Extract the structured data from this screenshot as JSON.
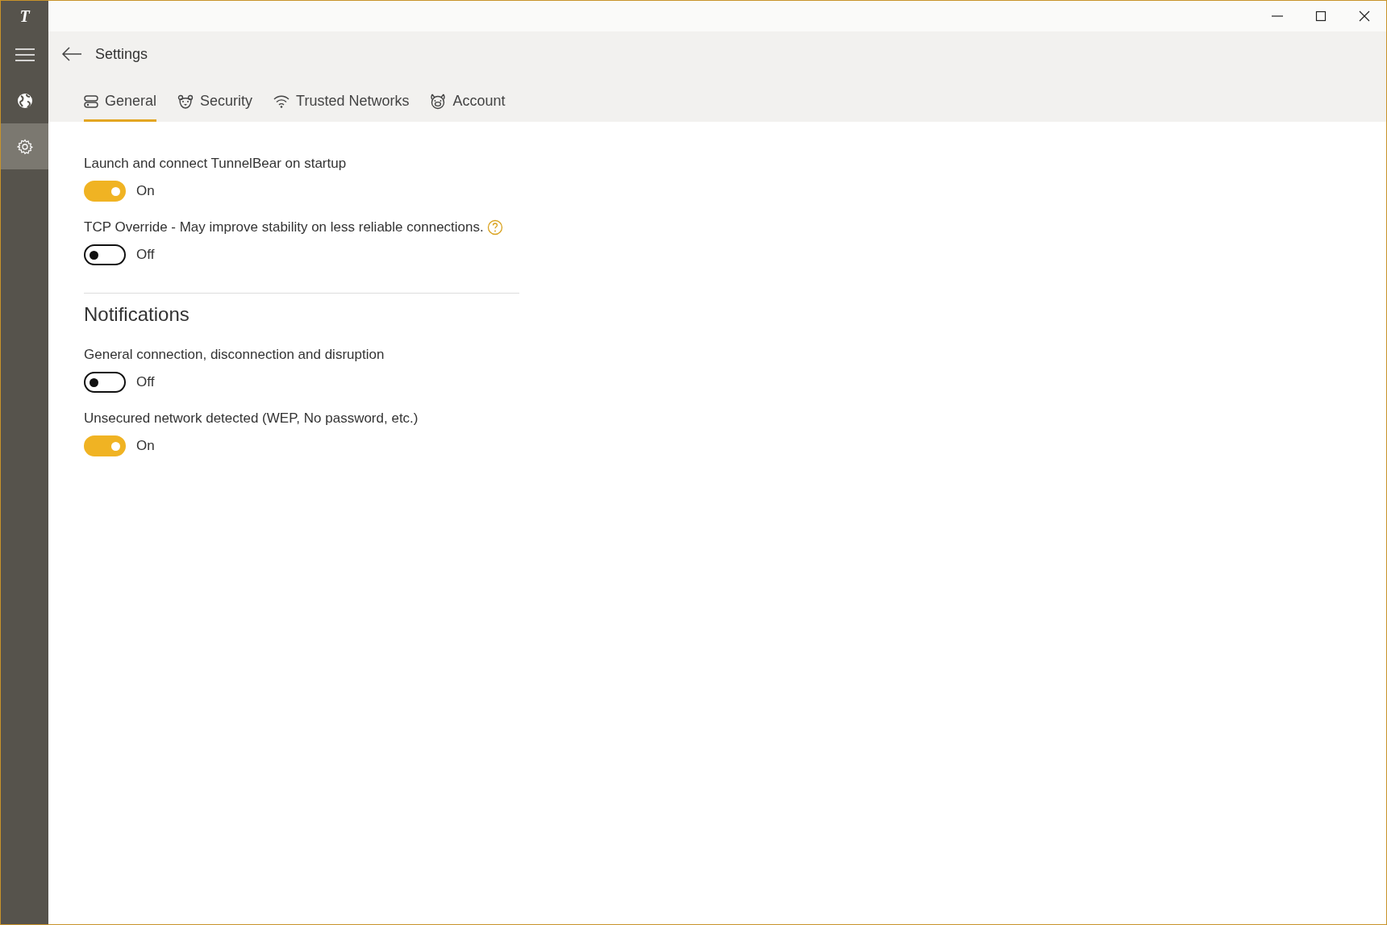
{
  "sidebar": {
    "logo": "T",
    "items": [
      {
        "kind": "menu",
        "selected": false
      },
      {
        "kind": "globe",
        "selected": false
      },
      {
        "kind": "settings",
        "selected": true
      }
    ]
  },
  "header": {
    "title": "Settings"
  },
  "tabs": [
    {
      "label": "General",
      "kind": "general",
      "selected": true
    },
    {
      "label": "Security",
      "kind": "bear",
      "selected": false
    },
    {
      "label": "Trusted Networks",
      "kind": "wifi",
      "selected": false
    },
    {
      "label": "Account",
      "kind": "pig",
      "selected": false
    }
  ],
  "settings": [
    {
      "label": "Launch and connect TunnelBear on startup",
      "on": true,
      "state_text": "On"
    },
    {
      "label": "TCP Override - May improve stability on less reliable connections.",
      "on": false,
      "state_text": "Off",
      "help": true
    }
  ],
  "notifications": {
    "heading": "Notifications",
    "items": [
      {
        "label": "General connection, disconnection and disruption",
        "on": false,
        "state_text": "Off"
      },
      {
        "label": "Unsecured network detected (WEP, No password, etc.)",
        "on": true,
        "state_text": "On"
      }
    ]
  }
}
